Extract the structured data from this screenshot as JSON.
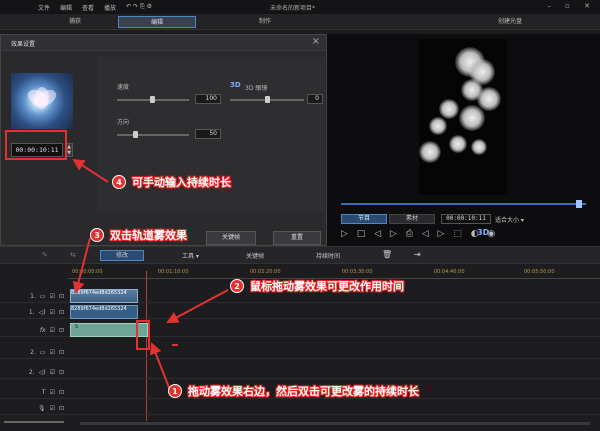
{
  "menu": {
    "items": [
      "文件",
      "编辑",
      "查看",
      "播放"
    ]
  },
  "window": {
    "title": "未命名的新项目*"
  },
  "modes": {
    "capture": "捕获",
    "edit": "编辑",
    "produce": "制作",
    "disc": "创建光盘"
  },
  "dialog": {
    "title": "效果设置",
    "duration": "00:00:10:11",
    "speed_label": "速度",
    "speed_value": "100",
    "direction_label": "方向",
    "direction_value": "50",
    "three_d_label": "3D 眼镜",
    "three_d_value": "0",
    "keyframe_button": "关键帧",
    "reset_button": "重置"
  },
  "preview": {
    "tab_project": "节目",
    "tab_clip": "素材",
    "timecode": "00:00:10:11",
    "size_label": "适合大小 ▾",
    "progress_fraction": 0.97
  },
  "timeline_toolbar": {
    "modify": "修改",
    "tools": "工具 ▾",
    "keyframes": "关键帧",
    "duration": "持续时间"
  },
  "ruler": {
    "ticks": [
      "00:00:00:00",
      "00:01:10:00",
      "00:02:20:00",
      "00:03:30:00",
      "00:04:40:00",
      "00:05:50:00"
    ]
  },
  "tracks": [
    {
      "label": "1."
    },
    {
      "label": "1."
    },
    {
      "label": "fx"
    },
    {
      "label": "2."
    },
    {
      "label": "2."
    },
    {
      "label": ""
    },
    {
      "label": ""
    }
  ],
  "clips": {
    "video_clip": "8289f674ed8d265324",
    "audio_clip": "8289f674ed8d265324",
    "fx_clip": "S"
  },
  "annotations": {
    "a1": {
      "num": "1",
      "text": "拖动雾效果右边，然后双击可更改雾的持续时长"
    },
    "a2": {
      "num": "2",
      "text": "鼠标拖动雾效果可更改作用时间"
    },
    "a3": {
      "num": "3",
      "text": "双击轨道雾效果"
    },
    "a4": {
      "num": "4",
      "text": "可手动输入持续时长"
    }
  },
  "colors": {
    "annotation_red": "#e23232",
    "accent_blue": "#4f87c5"
  }
}
